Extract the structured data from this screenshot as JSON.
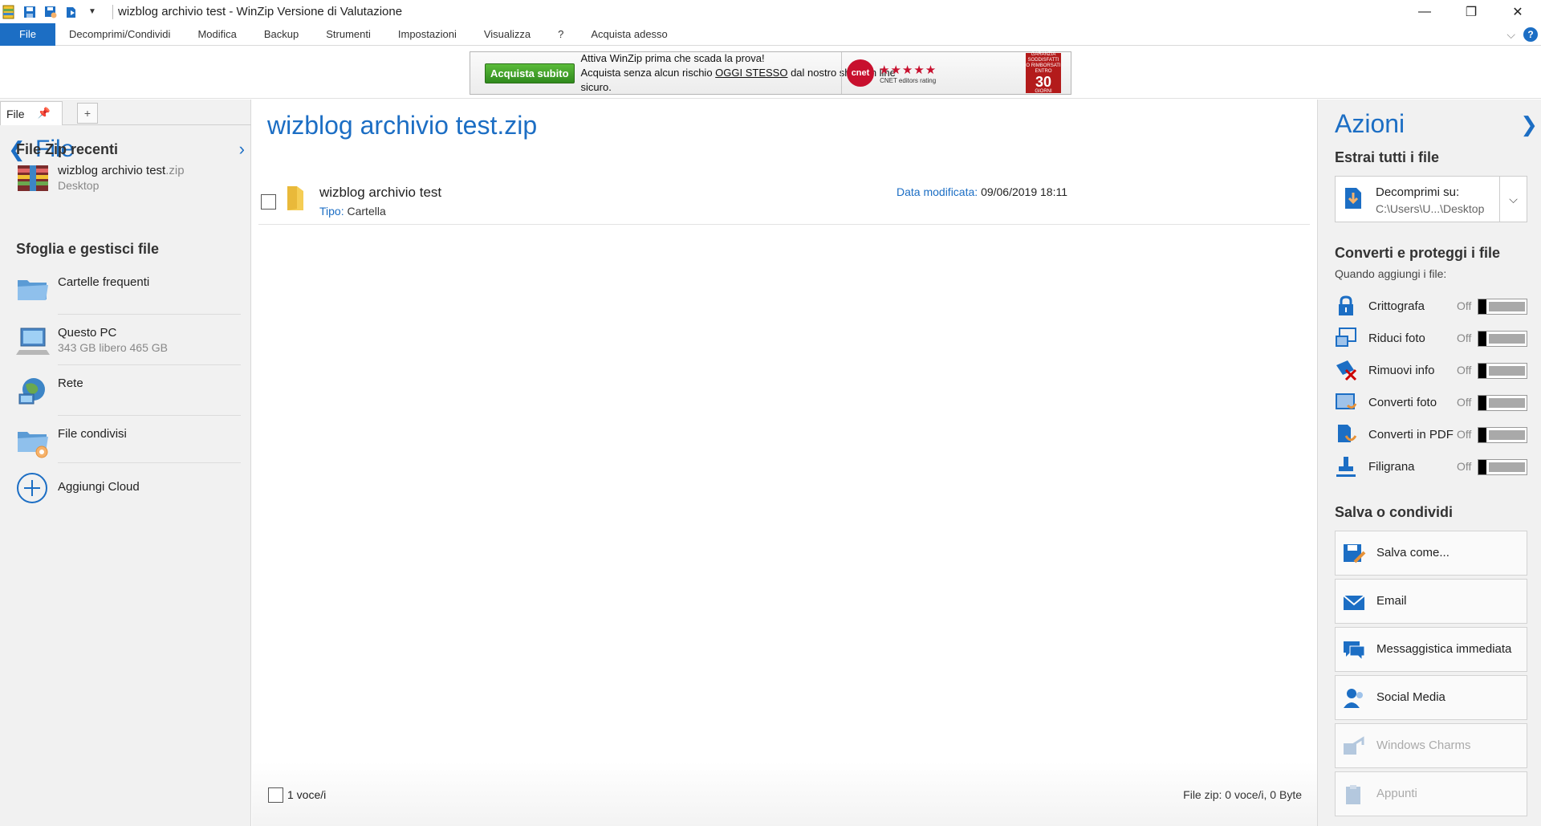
{
  "window": {
    "title": "wizblog archivio test - WinZip Versione di Valutazione",
    "controls": [
      "—",
      "❐",
      "✕"
    ]
  },
  "menu": {
    "items": [
      "File",
      "Decomprimi/Condividi",
      "Modifica",
      "Backup",
      "Strumenti",
      "Impostazioni",
      "Visualizza",
      "?",
      "Acquista adesso"
    ],
    "help_label": "?"
  },
  "banner": {
    "buy_label": "Acquista subito",
    "line1": "Attiva WinZip prima che scada la prova!",
    "line2_pre": "Acquista senza alcun rischio ",
    "line2_link": "OGGI STESSO",
    "line2_post": " dal nostro shop on line sicuro.",
    "cnet_logo": "cnet",
    "stars": "★★★★★",
    "rating_caption": "CNET editors rating",
    "badge_top": "GARANZIA SODDISFATTI O RIMBORSATI ENTRO",
    "badge_number": "30",
    "badge_bottom": "GIORNI"
  },
  "left": {
    "tab_label": "File",
    "add_tab_label": "+",
    "header_title": "File",
    "recent_heading": "File Zip recenti",
    "recent_items": [
      {
        "name": "wizblog archivio test",
        "ext": ".zip",
        "location": "Desktop"
      }
    ],
    "browse_heading": "Sfoglia e gestisci file",
    "places": [
      {
        "name": "Cartelle frequenti",
        "detail": ""
      },
      {
        "name": "Questo PC",
        "detail": "343 GB libero 465 GB"
      },
      {
        "name": "Rete",
        "detail": ""
      },
      {
        "name": "File condivisi",
        "detail": ""
      }
    ],
    "add_cloud": "Aggiungi Cloud"
  },
  "center": {
    "zip_title": "wizblog archivio test.zip",
    "entries": [
      {
        "name": "wizblog archivio test",
        "type_label": "Tipo:",
        "type": "Cartella",
        "modified_label": "Data modificata:",
        "modified": "09/06/2019 18:11"
      }
    ],
    "status_count": "1 voce/i",
    "status_zip": "File zip: 0 voce/i, 0 Byte"
  },
  "right": {
    "title": "Azioni",
    "extract_heading": "Estrai tutti i file",
    "unzip_label": "Decomprimi su:",
    "unzip_path": "C:\\Users\\U...\\Desktop",
    "convert_heading": "Converti e proteggi i file",
    "convert_sub": "Quando aggiungi i file:",
    "toggles": [
      {
        "label": "Crittografa",
        "state": "Off"
      },
      {
        "label": "Riduci foto",
        "state": "Off"
      },
      {
        "label": "Rimuovi info",
        "state": "Off"
      },
      {
        "label": "Converti foto",
        "state": "Off"
      },
      {
        "label": "Converti in PDF",
        "state": "Off"
      },
      {
        "label": "Filigrana",
        "state": "Off"
      }
    ],
    "share_heading": "Salva o condividi",
    "share_buttons": [
      "Salva come...",
      "Email",
      "Messaggistica immediata",
      "Social Media",
      "Windows Charms",
      "Appunti"
    ]
  },
  "colors": {
    "accent": "#1c6ec4",
    "panel_bg": "#f1f1f1",
    "banner_buy": "#3a9a26",
    "badge": "#b31b1b"
  }
}
